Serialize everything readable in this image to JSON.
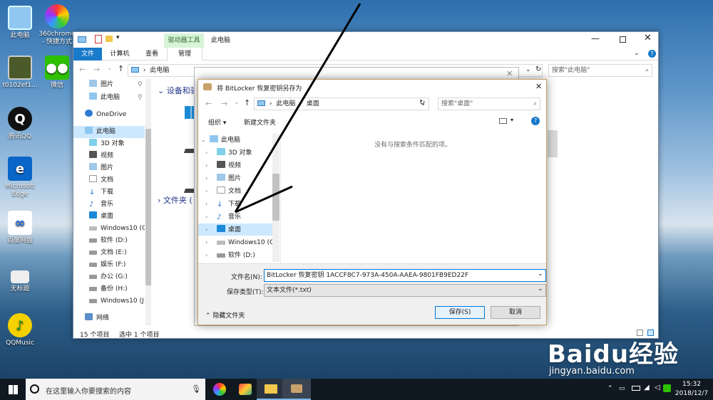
{
  "desktop": {
    "icons": [
      {
        "label": "此电脑",
        "icon": "computer-icon"
      },
      {
        "label": "360chrome\n- 快捷方式",
        "icon": "360chrome-icon"
      },
      {
        "label": "t0102ef1...",
        "icon": "image-file-icon"
      },
      {
        "label": "微信",
        "icon": "wechat-icon"
      },
      {
        "label": "腾讯QQ",
        "icon": "qq-icon"
      },
      {
        "label": "Microsoft\nEdge",
        "icon": "edge-icon"
      },
      {
        "label": "百度网盘",
        "icon": "baidu-netdisk-icon"
      },
      {
        "label": "无标题",
        "icon": "untitled-file-icon"
      },
      {
        "label": "QQMusic",
        "icon": "qqmusic-icon"
      }
    ],
    "watermark": "Baidu经验",
    "watermark_url": "jingyan.baidu.com"
  },
  "explorer": {
    "title": "此电脑",
    "contextual_tab": "驱动器工具",
    "tabs": [
      "文件",
      "计算机",
      "查看",
      "管理"
    ],
    "address": "此电脑",
    "search_placeholder": "搜索\"此电脑\"",
    "section_devices": "设备和驱",
    "section_folders": "文件夹 (",
    "nav": [
      {
        "label": "图片",
        "icon": "pictures-icon",
        "indent": 1,
        "pinned": true
      },
      {
        "label": "此电脑",
        "icon": "computer-icon",
        "indent": 1,
        "pinned": true
      },
      {
        "label": "OneDrive",
        "icon": "onedrive-icon",
        "indent": 0
      },
      {
        "label": "此电脑",
        "icon": "computer-icon",
        "indent": 0,
        "selected": true
      },
      {
        "label": "3D 对象",
        "icon": "3d-objects-icon",
        "indent": 1
      },
      {
        "label": "视频",
        "icon": "videos-icon",
        "indent": 1
      },
      {
        "label": "图片",
        "icon": "pictures-icon",
        "indent": 1
      },
      {
        "label": "文档",
        "icon": "documents-icon",
        "indent": 1
      },
      {
        "label": "下载",
        "icon": "downloads-icon",
        "indent": 1
      },
      {
        "label": "音乐",
        "icon": "music-icon",
        "indent": 1
      },
      {
        "label": "桌面",
        "icon": "desktop-icon",
        "indent": 1
      },
      {
        "label": "Windows10 (C:",
        "icon": "drive-c-icon",
        "indent": 1
      },
      {
        "label": "软件 (D:)",
        "icon": "drive-icon",
        "indent": 1
      },
      {
        "label": "文档 (E:)",
        "icon": "drive-icon",
        "indent": 1
      },
      {
        "label": "娱乐 (F:)",
        "icon": "drive-icon",
        "indent": 1
      },
      {
        "label": "办公 (G:)",
        "icon": "drive-icon",
        "indent": 1
      },
      {
        "label": "备份 (H:)",
        "icon": "drive-icon",
        "indent": 1
      },
      {
        "label": "Windows10 (J:)",
        "icon": "drive-icon",
        "indent": 1
      },
      {
        "label": "网络",
        "icon": "network-icon",
        "indent": 0
      }
    ],
    "status_items": "15 个项目",
    "status_selected": "选中 1 个项目"
  },
  "dialog": {
    "title": "将 BitLocker 恢复密钥另存为",
    "breadcrumb": [
      "此电脑",
      "桌面"
    ],
    "search_placeholder": "搜索\"桌面\"",
    "organize": "组织 ▾",
    "new_folder": "新建文件夹",
    "empty_message": "没有与搜索条件匹配的项。",
    "tree": [
      {
        "label": "此电脑",
        "icon": "computer-icon",
        "level": 0,
        "expanded": true
      },
      {
        "label": "3D 对象",
        "icon": "3d-objects-icon",
        "level": 1
      },
      {
        "label": "视频",
        "icon": "videos-icon",
        "level": 1
      },
      {
        "label": "图片",
        "icon": "pictures-icon",
        "level": 1
      },
      {
        "label": "文档",
        "icon": "documents-icon",
        "level": 1
      },
      {
        "label": "下载",
        "icon": "downloads-icon",
        "level": 1
      },
      {
        "label": "音乐",
        "icon": "music-icon",
        "level": 1
      },
      {
        "label": "桌面",
        "icon": "desktop-icon",
        "level": 1,
        "selected": true
      },
      {
        "label": "Windows10 (C:",
        "icon": "drive-c-icon",
        "level": 1
      },
      {
        "label": "软件 (D:)",
        "icon": "drive-icon",
        "level": 1
      }
    ],
    "filename_label": "文件名(N):",
    "filename_value": "BitLocker 恢复密钥 1ACCF8C7-973A-450A-AAEA-9801FB9ED22F",
    "filetype_label": "保存类型(T):",
    "filetype_value": "文本文件(*.txt)",
    "hide_folders": "隐藏文件夹",
    "save": "保存(S)",
    "cancel": "取消"
  },
  "taskbar": {
    "search_placeholder": "在这里输入你要搜索的内容",
    "time": "15:32",
    "date": "2018/12/7",
    "apps": [
      "360chrome-icon",
      "paint-icon",
      "file-explorer-icon",
      "bitlocker-icon"
    ]
  },
  "colors": {
    "accent": "#0078d7",
    "selected": "#cce8ff",
    "contextual_tab": "#c8f0c8",
    "dialog_border": "#c9a26b"
  }
}
